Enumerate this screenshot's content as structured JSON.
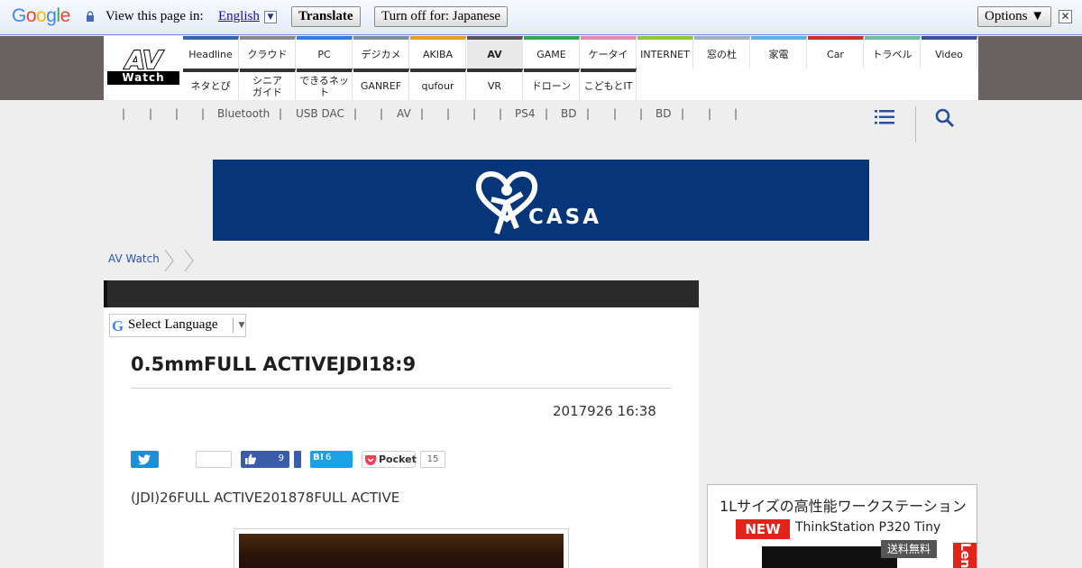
{
  "translate_bar": {
    "logo": "Google",
    "view_text": "View this page in:",
    "language": "English",
    "translate_label": "Translate",
    "turn_off_label": "Turn off for: Japanese",
    "options_label": "Options ▼",
    "close_glyph": "✕"
  },
  "site": {
    "logo_top": "AV",
    "logo_bottom": "Watch"
  },
  "nav_top": [
    {
      "label": "Headline",
      "color": "#3566b0"
    },
    {
      "label": "クラウド",
      "color": "#888888"
    },
    {
      "label": "PC",
      "color": "#2f7ed8"
    },
    {
      "label": "デジカメ",
      "color": "#7c8ea0"
    },
    {
      "label": "AKIBA",
      "color": "#e6a020"
    },
    {
      "label": "AV",
      "color": "#555555"
    },
    {
      "label": "GAME",
      "color": "#32a852"
    },
    {
      "label": "ケータイ",
      "color": "#e58ab0"
    },
    {
      "label": "INTERNET",
      "color": "#8dc63f"
    },
    {
      "label": "窓の杜",
      "color": "#9cb0c0"
    },
    {
      "label": "家電",
      "color": "#5ab4e8"
    },
    {
      "label": "Car",
      "color": "#c8322d"
    },
    {
      "label": "トラベル",
      "color": "#6cc0a0"
    },
    {
      "label": "Video",
      "color": "#3a4f9a"
    }
  ],
  "nav_bottom": [
    {
      "label": "ネタとぴ"
    },
    {
      "label": "シニア\nガイド"
    },
    {
      "label": "できるネット"
    },
    {
      "label": "GANREF"
    },
    {
      "label": "qufour"
    },
    {
      "label": "VR"
    },
    {
      "label": "ドローン"
    },
    {
      "label": "こどもとIT"
    }
  ],
  "subnav": {
    "bluetooth": "Bluetooth",
    "usbdac": "USB DAC",
    "av": "AV",
    "ps4": "PS4",
    "bd1": "BD",
    "bd2": "BD"
  },
  "banner": {
    "brand": "CASA",
    "bg_color": "#06357a"
  },
  "breadcrumb": {
    "home": "AV Watch"
  },
  "article": {
    "lang_select": "Select Language",
    "title": "0.5mmFULL ACTIVEJDI18:9",
    "date": "2017926 16:38",
    "lead": "(JDI)26FULL ACTIVE201878FULL ACTIVE",
    "share": {
      "facebook_count": "9",
      "hatena_label": "B!",
      "hatena_count": "6",
      "pocket_label": "Pocket",
      "pocket_count": "15"
    }
  },
  "side_ad": {
    "title": "1Lサイズの高性能ワークステーション",
    "badge": "NEW",
    "product": "ThinkStation P320 Tiny",
    "shipping": "送料無料",
    "brand": "Lenovo"
  }
}
